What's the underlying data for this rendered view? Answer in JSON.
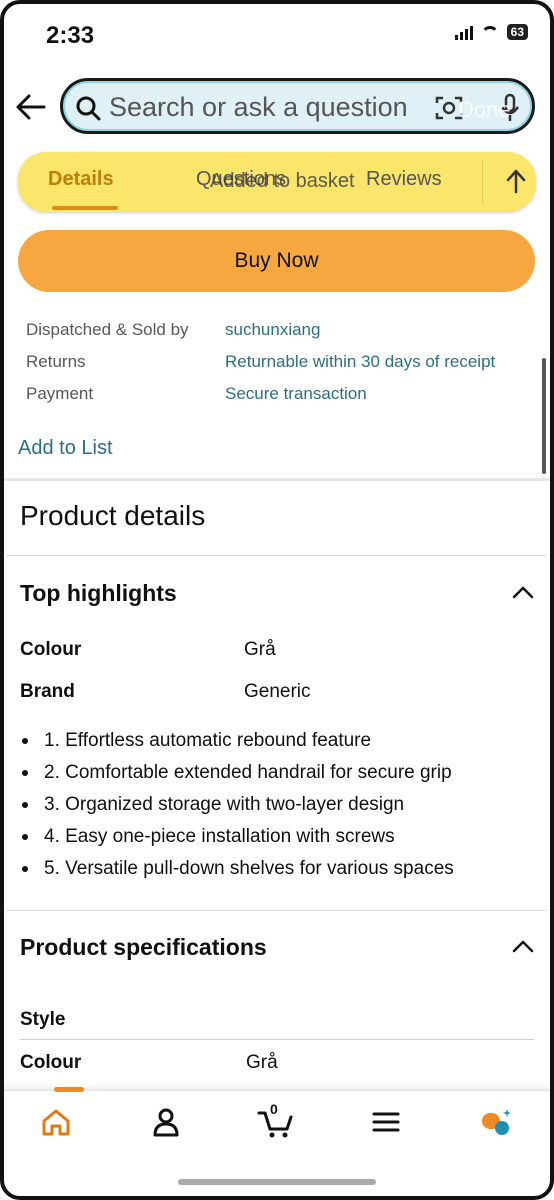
{
  "status_bar": {
    "time": "2:33",
    "battery": "63"
  },
  "search": {
    "placeholder": "Search or ask a question",
    "overlay_label": "Done"
  },
  "tabs": [
    {
      "label": "Details"
    },
    {
      "label": "Questions"
    },
    {
      "label": "Reviews"
    }
  ],
  "basket_overlay": "Added to basket",
  "buy_now_label": "Buy Now",
  "info_rows": [
    {
      "label": "Dispatched & Sold by",
      "value": "suchunxiang"
    },
    {
      "label": "Returns",
      "value": "Returnable within 30 days of receipt"
    },
    {
      "label": "Payment",
      "value": "Secure transaction"
    }
  ],
  "add_to_list_label": "Add to List",
  "product_details_title": "Product details",
  "top_highlights": {
    "title": "Top highlights",
    "attributes": [
      {
        "label": "Colour",
        "value": "Grå"
      },
      {
        "label": "Brand",
        "value": "Generic"
      }
    ],
    "bullets": [
      "1. Effortless automatic rebound feature",
      "2. Comfortable extended handrail for secure grip",
      "3. Organized storage with two-layer design",
      "4. Easy one-piece installation with screws",
      "5. Versatile pull-down shelves for various spaces"
    ]
  },
  "product_specifications": {
    "title": "Product specifications",
    "style_label": "Style",
    "attributes": [
      {
        "label": "Colour",
        "value": "Grå"
      }
    ]
  },
  "bottom_nav": {
    "cart_count": "0",
    "items": [
      "home-icon",
      "account-icon",
      "cart-icon",
      "menu-icon",
      "rufus-assistant-icon"
    ]
  },
  "colors": {
    "accent_orange": "#f7a740",
    "tab_bar_yellow": "#fbe56a",
    "link_teal": "#2b6f83",
    "active_tab": "#c27d0e"
  }
}
